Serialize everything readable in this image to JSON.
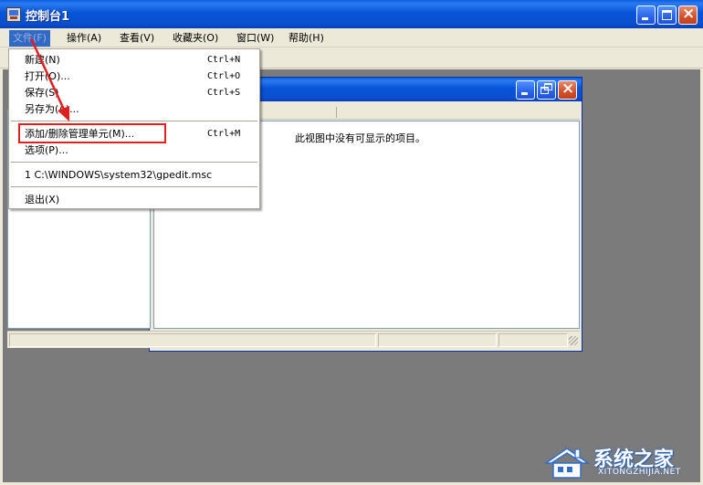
{
  "window": {
    "title": "控制台1"
  },
  "menubar": {
    "items": [
      {
        "label": "文件(F)"
      },
      {
        "label": "操作(A)"
      },
      {
        "label": "查看(V)"
      },
      {
        "label": "收藏夹(O)"
      },
      {
        "label": "窗口(W)"
      },
      {
        "label": "帮助(H)"
      }
    ]
  },
  "file_menu": {
    "items": [
      {
        "label": "新建(N)",
        "shortcut": "Ctrl+N"
      },
      {
        "label": "打开(O)...",
        "shortcut": "Ctrl+O"
      },
      {
        "label": "保存(S)",
        "shortcut": "Ctrl+S"
      },
      {
        "label": "另存为(A)..."
      },
      {
        "label": "添加/删除管理单元(M)...",
        "shortcut": "Ctrl+M"
      },
      {
        "label": "选项(P)..."
      },
      {
        "label": "1 C:\\WINDOWS\\system32\\gpedit.msc"
      },
      {
        "label": "退出(X)"
      }
    ]
  },
  "child_window": {
    "empty_message": "此视图中没有可显示的项目。"
  },
  "colors": {
    "title_bar": "#0a5fe0",
    "desktop": "#7b7b7b",
    "highlight_box": "#e02020",
    "arrow": "#e02020"
  },
  "watermark": {
    "title": "系统之家",
    "subtitle": "XITONGZHIJIA.NET"
  }
}
